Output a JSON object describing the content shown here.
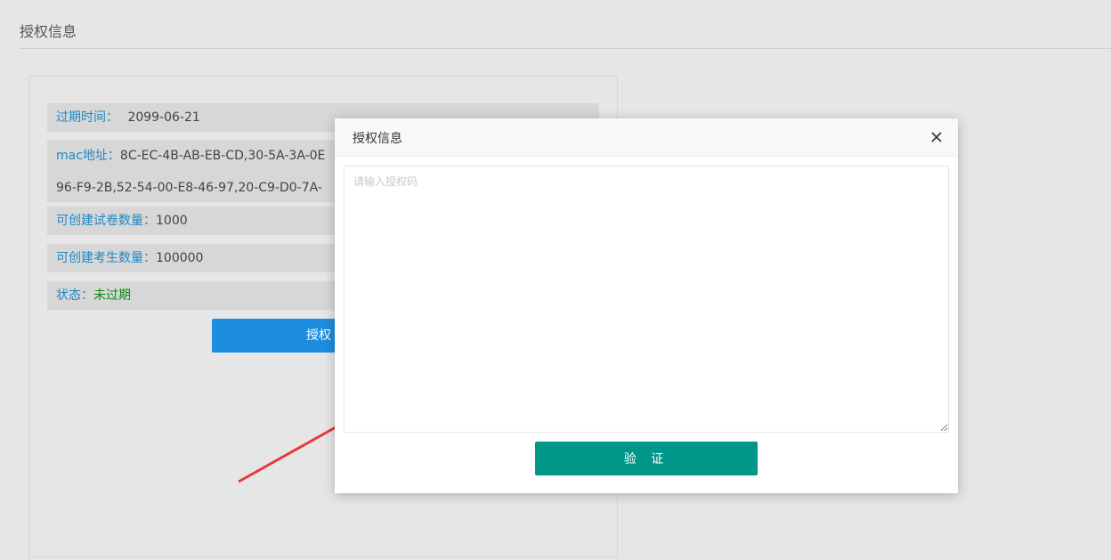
{
  "page": {
    "title": "授权信息"
  },
  "info": {
    "expire": {
      "label": "过期时间：",
      "value": "2099-06-21"
    },
    "mac": {
      "label": "mac地址：",
      "value_line1": "8C-EC-4B-AB-EB-CD,30-5A-3A-0E",
      "value_line2": "96-F9-2B,52-54-00-E8-46-97,20-C9-D0-7A-"
    },
    "papers": {
      "label": "可创建试卷数量：",
      "value": "1000"
    },
    "examinees": {
      "label": "可创建考生数量：",
      "value": "100000"
    },
    "status": {
      "label": "状态：",
      "value": "未过期",
      "color": "#0a8a0a"
    }
  },
  "auth_button": {
    "label": "授权"
  },
  "modal": {
    "title": "授权信息",
    "textarea_placeholder": "请输入授权码",
    "verify_label": "验 证",
    "verify_color": "#009688"
  },
  "annotation": {
    "arrow_color": "#e8383d"
  }
}
